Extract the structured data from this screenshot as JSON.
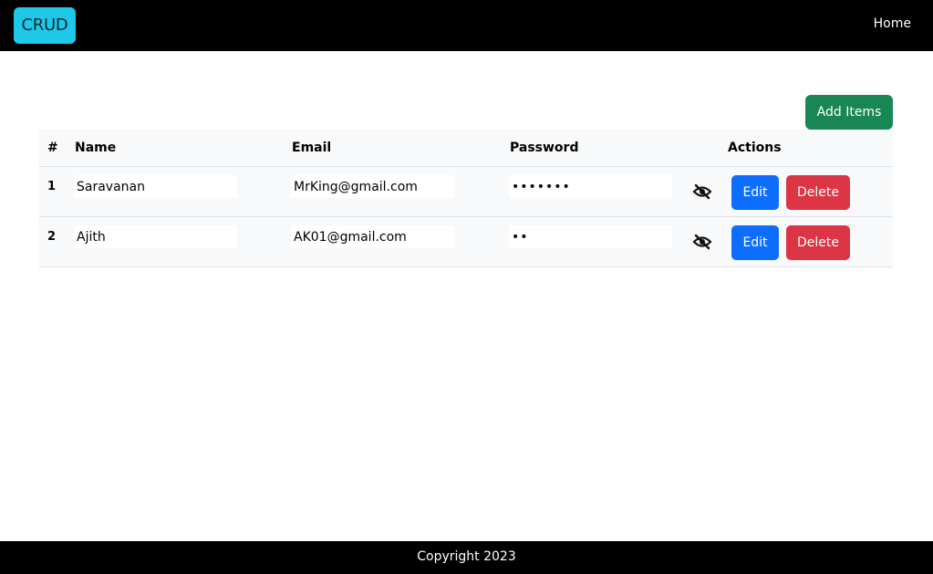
{
  "navbar": {
    "brand": "CRUD",
    "home_link": "Home"
  },
  "toolbar": {
    "add_label": "Add Items"
  },
  "table": {
    "headers": [
      "#",
      "Name",
      "Email",
      "Password",
      "Actions"
    ],
    "rows": [
      {
        "num": "1",
        "name": "Saravanan",
        "email": "MrKing@gmail.com",
        "password": "•••••••",
        "edit": "Edit",
        "delete": "Delete"
      },
      {
        "num": "2",
        "name": "Ajith",
        "email": "AK01@gmail.com",
        "password": "••",
        "edit": "Edit",
        "delete": "Delete"
      }
    ]
  },
  "footer": {
    "copyright": "Copyright 2023"
  },
  "colors": {
    "brand": "#1ec8e8",
    "add": "#198754",
    "edit": "#0d6efd",
    "delete": "#dc3545"
  },
  "icons": {
    "password_toggle": "eye-slash-icon"
  }
}
